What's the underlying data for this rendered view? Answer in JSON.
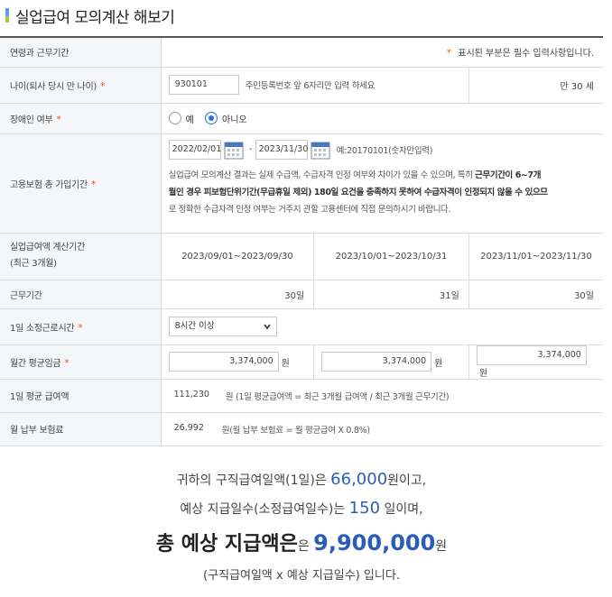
{
  "title": "실업급여 모의계산 해보기",
  "header_row": {
    "label": "연령과 근무기간",
    "note_star": "*",
    "note": "표시된 부분은 필수 입력사항입니다."
  },
  "age": {
    "label": "나이(퇴사 당시 만 나이)",
    "value": "930101",
    "help": "주민등록번호 앞 6자리만 입력 하세요",
    "result": "만 30 세"
  },
  "disability": {
    "label": "장애인 여부",
    "options": [
      "예",
      "아니오"
    ],
    "selected": "아니오"
  },
  "insurance": {
    "label": "고용보험 총 가입기간",
    "start": "2022/02/01",
    "dash": "-",
    "end": "2023/11/30",
    "example": "예:20170101(숫자만입력)",
    "note_1": "실업급여 모의계산 결과는 실제 수급액, 수급자격 인정 여부와 차이가 있을 수 있으며, 특히 ",
    "note_bold_1": "근무기간이 6~7개",
    "note_bold_2": "월인 경우 피보험단위기간(무급휴일 제외) 180일 요건을 충족하지 못하여 수급자격이 인정되지 않을 수 있으므",
    "note_2": "로 정확한 수급자격 인정 여부는 거주지 관할 고용센터에 직접 문의하시기 바랍니다."
  },
  "calc_period": {
    "label_line1": "실업급여액 계산기간",
    "label_line2": "(최근 3개월)",
    "periods": [
      "2023/09/01~2023/09/30",
      "2023/10/01~2023/10/31",
      "2023/11/01~2023/11/30"
    ]
  },
  "work_days": {
    "label": "근무기간",
    "values": [
      "30일",
      "31일",
      "30일"
    ]
  },
  "daily_hours": {
    "label": "1일 소정근로시간",
    "selected": "8시간 이상"
  },
  "monthly_wage": {
    "label": "월간 평균임금",
    "values": [
      "3,374,000",
      "3,374,000",
      "3,374,000"
    ],
    "unit": "원"
  },
  "daily_wage": {
    "label": "1일 평균 급여액",
    "value": "111,230",
    "formula": "원 (1일 평균급여액 = 최근 3개월 급여액 / 최근 3개월 근무기간)"
  },
  "insurance_fee": {
    "label": "월 납부 보험료",
    "value": "26,992",
    "formula": "원(월 납부 보험료 = 월 평균급여 X 0.8%)"
  },
  "summary": {
    "line1_pre": "귀하의 구직급여일액(1일)은 ",
    "daily_amount": "66,000",
    "line1_post": "원이고,",
    "line2_pre": "예상 지급일수(소정급여일수)는 ",
    "days": "150",
    "line2_post": " 일이며,",
    "line3_pre": "총 예상 지급액은",
    "line3_small": "은 ",
    "total": "9,900,000",
    "line3_post": "원",
    "line4": "(구직급여일액 x 예상 지급일수) 입니다."
  },
  "colors": {
    "accent": "#2b5db8",
    "required": "#e85a20",
    "label_bg": "#f5f6f8"
  },
  "icons": {
    "calendar": "calendar-icon",
    "dropdown": "chevron-down-icon"
  }
}
